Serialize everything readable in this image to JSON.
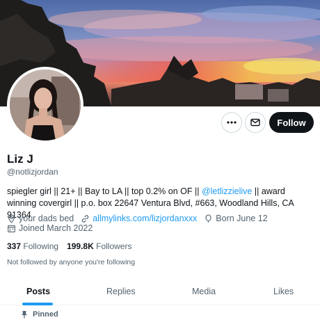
{
  "profile": {
    "name": "Liz J",
    "handle": "@notlizjordan",
    "bio_text1": "spiegler girl || 21+ || Bay to LA || top 0.2% on OF || ",
    "bio_mention": "@letlizzielive",
    "bio_text2": " || award winning covergirl || p.o. box 22647 Ventura Blvd, #663, Woodland Hills, CA 91364",
    "location": "your dads bed",
    "website": "allmylinks.com/lizjordanxxx",
    "birthday": "Born June 12",
    "joined": "Joined March 2022",
    "following_count": "337",
    "following_label": "Following",
    "followers_count": "199.8K",
    "followers_label": "Followers",
    "not_followed": "Not followed by anyone you're following"
  },
  "actions": {
    "follow_label": "Follow",
    "more_icon": "more-icon",
    "message_icon": "mail-icon"
  },
  "tabs": {
    "posts": "Posts",
    "replies": "Replies",
    "media": "Media",
    "likes": "Likes",
    "active": "Posts"
  },
  "pinned_label": "Pinned",
  "colors": {
    "accent": "#1d9bf0",
    "text": "#0f1419",
    "muted": "#536471",
    "follow_bg": "#0f1419"
  }
}
